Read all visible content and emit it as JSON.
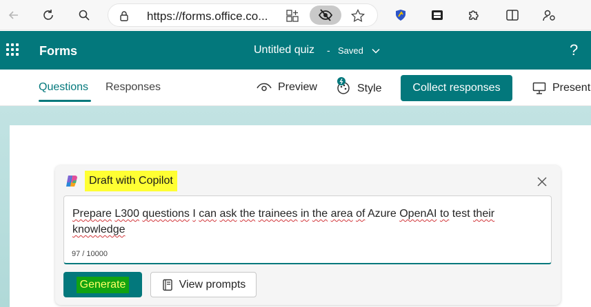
{
  "browser": {
    "url": "https://forms.office.co..."
  },
  "app": {
    "name": "Forms",
    "quiz_title": "Untitled quiz",
    "separator": "-",
    "save_status": "Saved",
    "help_label": "?"
  },
  "tabs": [
    {
      "label": "Questions",
      "active": true
    },
    {
      "label": "Responses",
      "active": false
    }
  ],
  "commands": {
    "preview": "Preview",
    "style": "Style",
    "collect": "Collect responses",
    "present": "Present"
  },
  "copilot": {
    "title": "Draft with Copilot",
    "prompt_words": [
      "Prepare",
      "L300",
      "questions",
      "I",
      "can",
      "ask",
      "the",
      "trainees",
      "in",
      "the",
      "area",
      "of",
      "Azure",
      "OpenAI",
      "to",
      "test",
      "their",
      "knowledge"
    ],
    "char_count": "97 / 10000",
    "generate_label": "Generate",
    "view_prompts_label": "View prompts"
  },
  "colors": {
    "brand": "#03787c",
    "highlight": "#ffff33",
    "generate_highlight": "#11a311"
  }
}
